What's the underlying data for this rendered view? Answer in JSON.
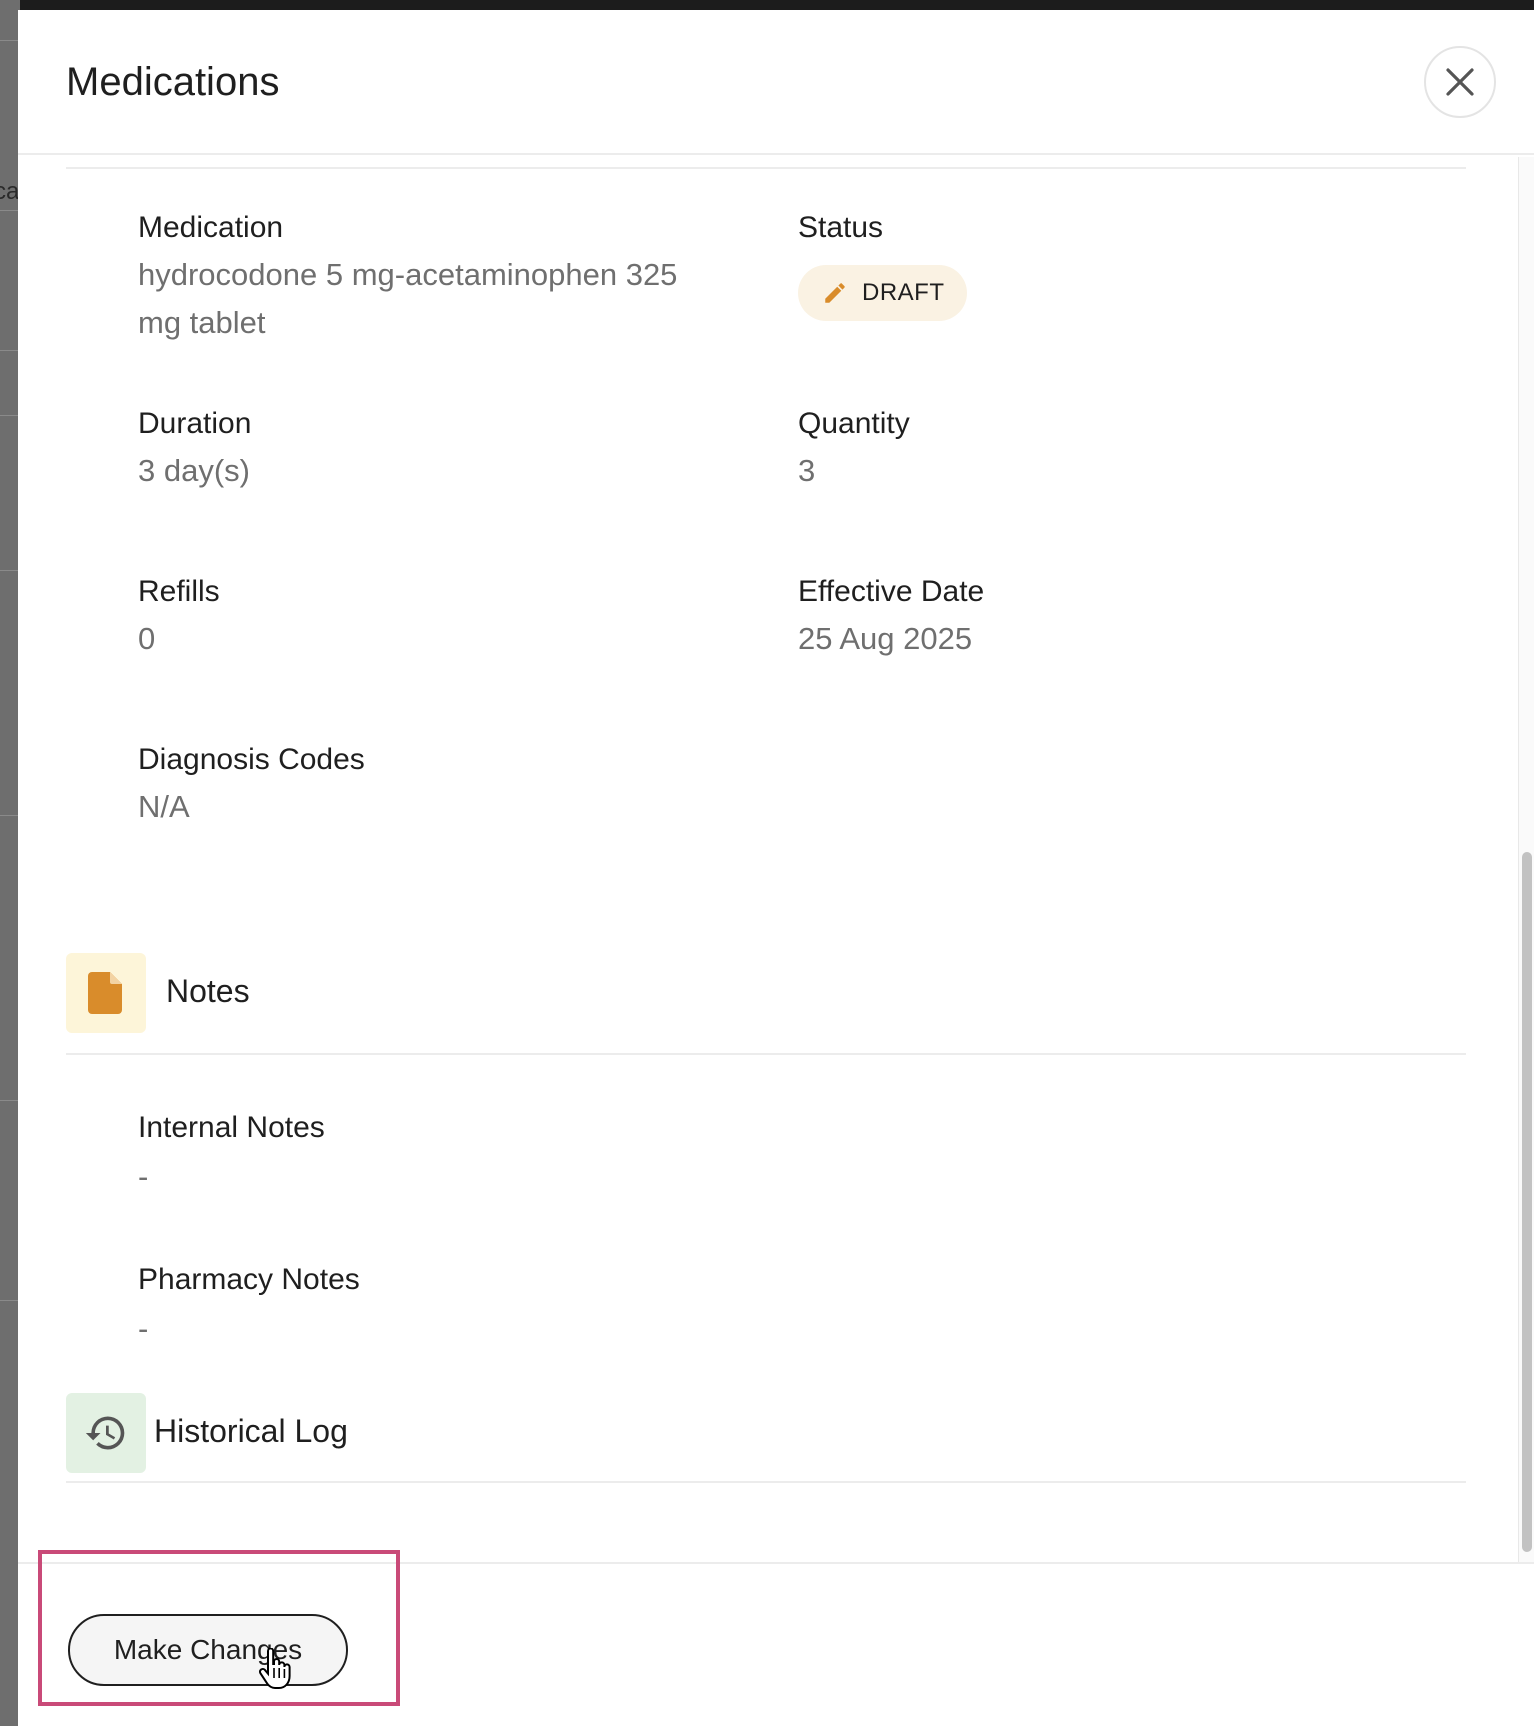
{
  "background": {
    "partial_text": "ca"
  },
  "drawer": {
    "title": "Medications",
    "close_label": "Close"
  },
  "fields": {
    "medication": {
      "label": "Medication",
      "value_line1": "hydrocodone 5 mg-acetaminophen 325",
      "value_line2": "mg tablet"
    },
    "status": {
      "label": "Status",
      "value": "DRAFT",
      "icon": "pencil-icon",
      "color": "#d98c2b"
    },
    "duration": {
      "label": "Duration",
      "value": "3 day(s)"
    },
    "quantity": {
      "label": "Quantity",
      "value": "3"
    },
    "refills": {
      "label": "Refills",
      "value": "0"
    },
    "effective_date": {
      "label": "Effective Date",
      "value": "25 Aug 2025"
    },
    "diagnosis_codes": {
      "label": "Diagnosis Codes",
      "value": "N/A"
    }
  },
  "notes_section": {
    "title": "Notes",
    "icon": "document-icon",
    "icon_color": "#d98c2b",
    "icon_bg": "#fdf5d9",
    "internal_notes": {
      "label": "Internal Notes",
      "value": "-"
    },
    "pharmacy_notes": {
      "label": "Pharmacy Notes",
      "value": "-"
    }
  },
  "history_section": {
    "title": "Historical Log",
    "icon": "history-icon",
    "icon_bg": "#e3f1e3"
  },
  "footer": {
    "make_changes_label": "Make Changes",
    "highlight_color": "#c94a78"
  }
}
